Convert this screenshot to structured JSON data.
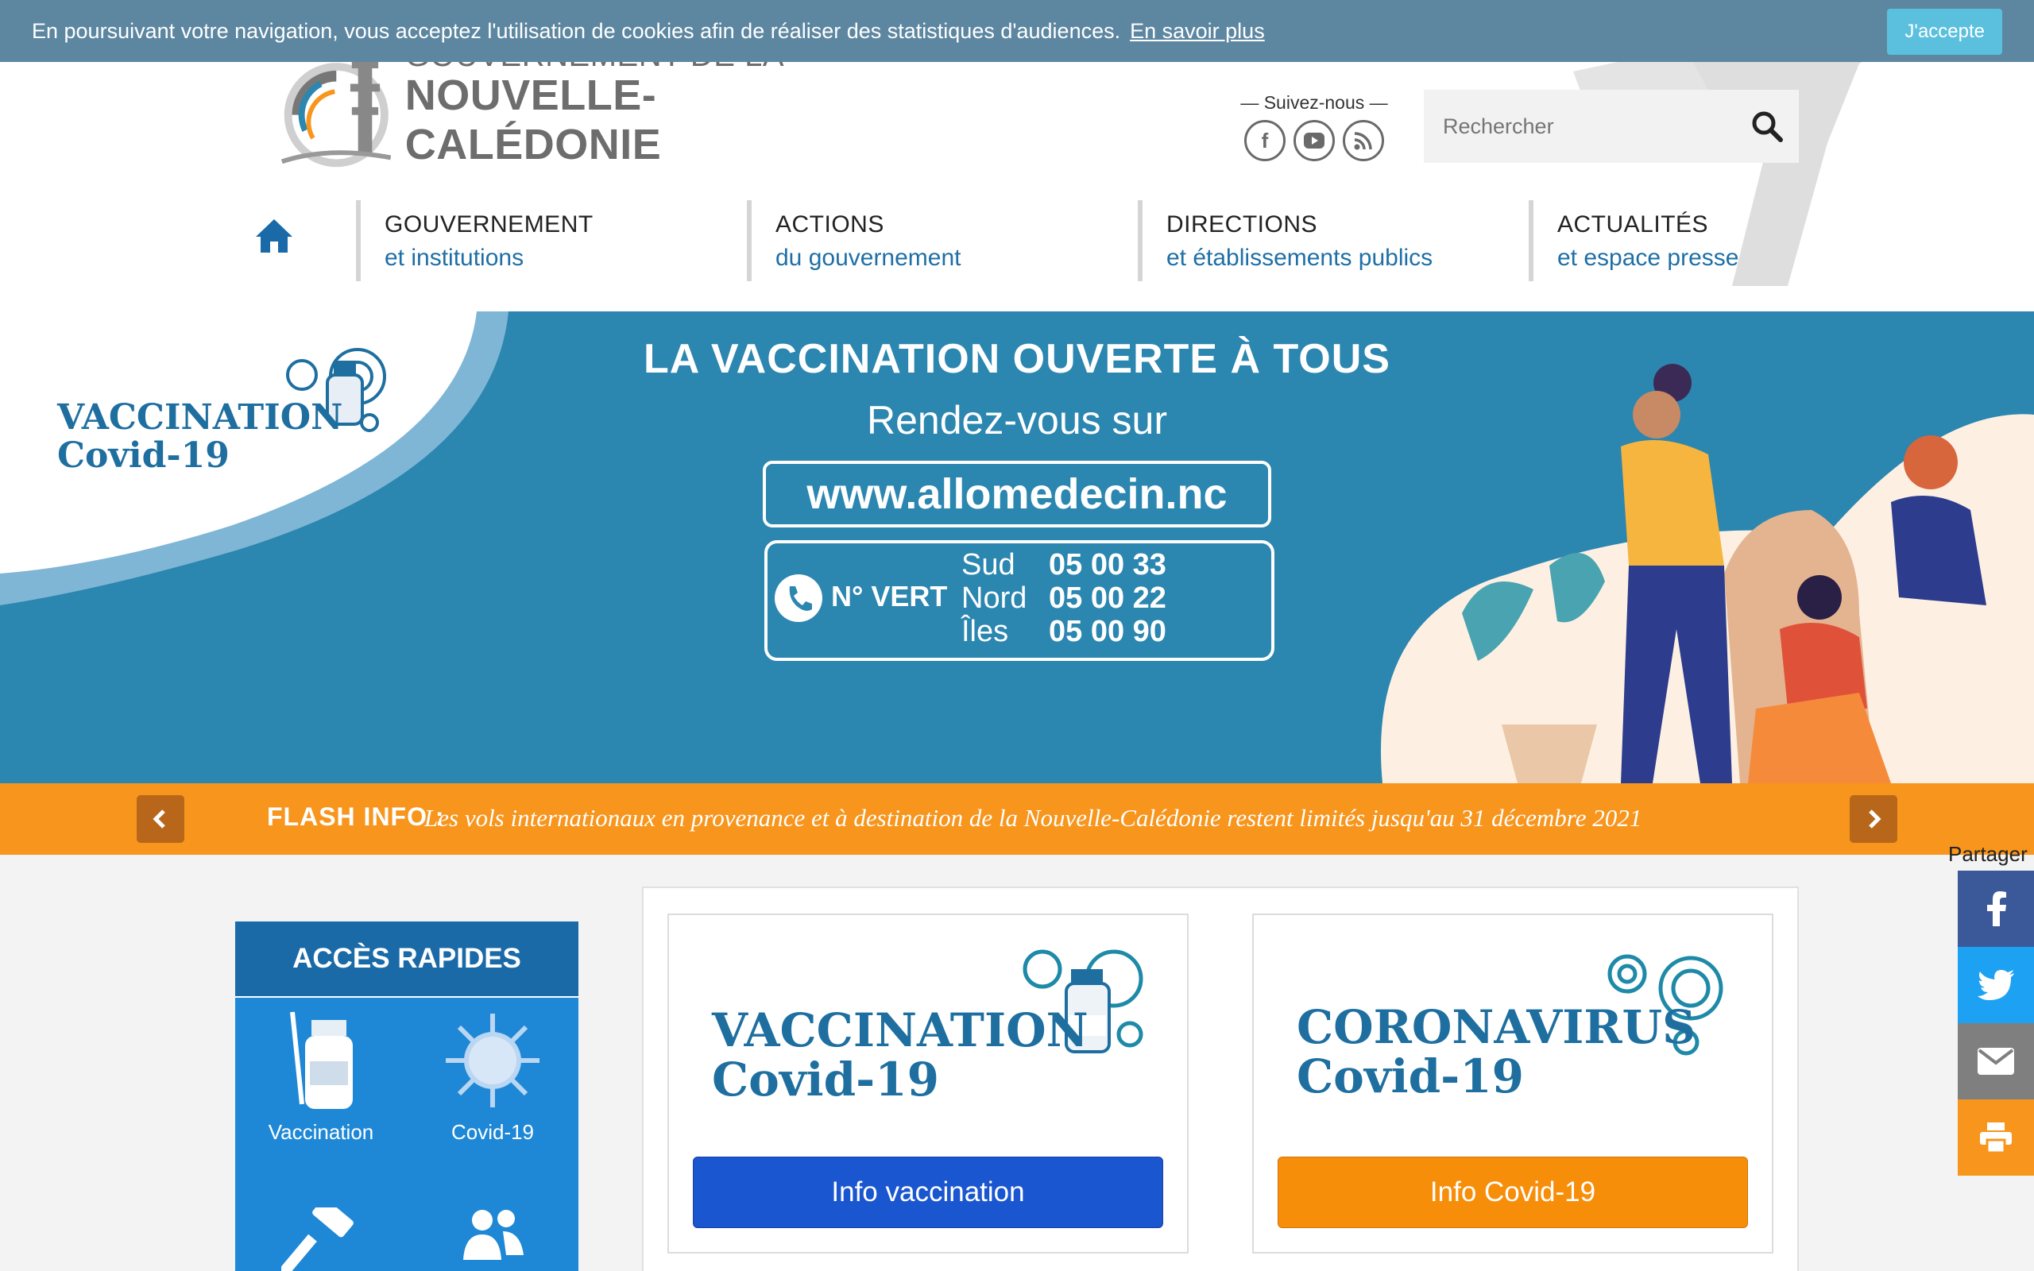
{
  "cookie": {
    "text": "En poursuivant votre navigation, vous acceptez l'utilisation de cookies afin de réaliser des statistiques d'audiences.",
    "link": "En savoir plus",
    "accept": "J'accepte"
  },
  "header": {
    "logo_line1": "GOUVERNEMENT DE LA",
    "logo_line2": "NOUVELLE-CALÉDONIE",
    "follow_label": "— Suivez-nous —",
    "social": [
      "facebook-icon",
      "youtube-icon",
      "rss-icon"
    ],
    "search_placeholder": "Rechercher"
  },
  "nav": {
    "items": [
      {
        "title": "GOUVERNEMENT",
        "sub": "et institutions"
      },
      {
        "title": "ACTIONS",
        "sub": "du gouvernement"
      },
      {
        "title": "DIRECTIONS",
        "sub": "et établissements publics"
      },
      {
        "title": "ACTUALITÉS",
        "sub": "et espace presse"
      }
    ]
  },
  "banner": {
    "vacc_line1": "VACCINATION",
    "vacc_line2": "Covid-19",
    "headline": "LA VACCINATION OUVERTE À TOUS",
    "rdv": "Rendez-vous sur",
    "url": "www.allomedecin.nc",
    "green_label": "N° VERT",
    "numbers": [
      {
        "zone": "Sud",
        "num": "05 00 33"
      },
      {
        "zone": "Nord",
        "num": "05 00 22"
      },
      {
        "zone": "Îles",
        "num": "05 00 90"
      }
    ]
  },
  "flash": {
    "label": "FLASH INFO :",
    "text": "Les vols internationaux en provenance et à destination de la Nouvelle-Calédonie restent limités jusqu'au 31 décembre 2021"
  },
  "share": {
    "label": "Partager",
    "buttons": [
      "facebook-icon",
      "twitter-icon",
      "mail-icon",
      "print-icon"
    ],
    "colors": {
      "facebook": "#3b5998",
      "twitter": "#1da1f2",
      "mail": "#7f7f7f",
      "print": "#f7951d"
    }
  },
  "quick": {
    "title": "ACCÈS RAPIDES",
    "items": [
      {
        "label": "Vaccination",
        "icon": "vaccine-vial-icon"
      },
      {
        "label": "Covid-19",
        "icon": "virus-icon"
      },
      {
        "label": "",
        "icon": "gavel-icon"
      },
      {
        "label": "",
        "icon": "people-icon"
      }
    ]
  },
  "cards": [
    {
      "title1": "VACCINATION",
      "title2": "Covid-19",
      "button": "Info vaccination",
      "color": "#1a56d0"
    },
    {
      "title1": "CORONAVIRUS",
      "title2": "Covid-19",
      "button": "Info Covid-19",
      "color": "#f78e0a"
    }
  ]
}
